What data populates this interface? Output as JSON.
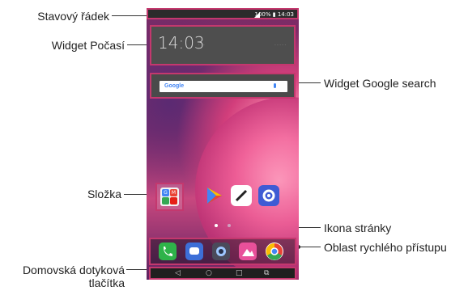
{
  "callouts": {
    "status_bar": "Stavový řádek",
    "weather_widget": "Widget Počasí",
    "google_widget": "Widget Google search",
    "folder": "Složka",
    "page_icon": "Ikona stránky",
    "quick_access": "Oblast rychlého přístupu",
    "home_keys_line1": "Domovská dotyková",
    "home_keys_line2": "tlačítka"
  },
  "screen": {
    "status": {
      "text": "100% ▮ 14:03",
      "icons": [
        "signal-icon",
        "battery-icon"
      ]
    },
    "weather": {
      "time": "14:03"
    },
    "search": {
      "logo": "Google",
      "icons": [
        "mic-icon"
      ]
    },
    "folder_mini_apps": [
      "G",
      "M",
      "",
      ""
    ],
    "home_apps": [
      {
        "name": "play-store-icon",
        "color": "#ffffff"
      },
      {
        "name": "quickmemo-icon",
        "color": "#ffffff"
      },
      {
        "name": "settings-icon",
        "color": "#3f5bd4"
      }
    ],
    "pages": {
      "count": 2,
      "active": 1
    },
    "dock_apps": [
      {
        "name": "phone-icon",
        "color": "#2fb34a"
      },
      {
        "name": "messages-icon",
        "color": "#3d6fd8"
      },
      {
        "name": "camera-icon",
        "color": "#4a4a5a"
      },
      {
        "name": "gallery-icon",
        "color": "#e8509a"
      },
      {
        "name": "chrome-icon",
        "color": "#e94235"
      }
    ],
    "nav_keys": [
      "◁",
      "○",
      "□",
      "⧉"
    ]
  },
  "colors": {
    "highlight": "#c4386e",
    "status_bar": "#2b2b2b"
  }
}
